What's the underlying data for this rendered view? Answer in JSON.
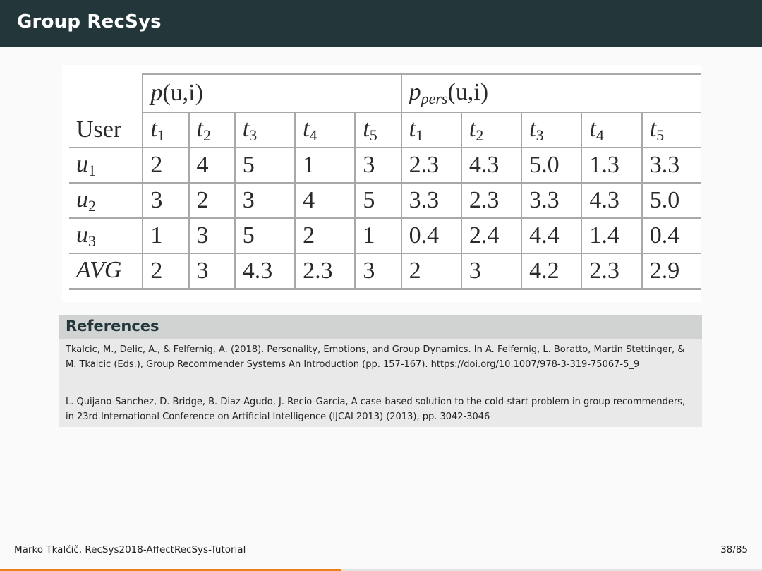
{
  "slide": {
    "title": "Group RecSys"
  },
  "table": {
    "user_header": "User",
    "group1_base": "p",
    "group1_args": "(u,i)",
    "group2_base": "p",
    "group2_sub": "pers",
    "group2_args": "(u,i)",
    "columns": [
      {
        "base": "t",
        "sub": "1"
      },
      {
        "base": "t",
        "sub": "2"
      },
      {
        "base": "t",
        "sub": "3"
      },
      {
        "base": "t",
        "sub": "4"
      },
      {
        "base": "t",
        "sub": "5"
      },
      {
        "base": "t",
        "sub": "1"
      },
      {
        "base": "t",
        "sub": "2"
      },
      {
        "base": "t",
        "sub": "3"
      },
      {
        "base": "t",
        "sub": "4"
      },
      {
        "base": "t",
        "sub": "5"
      }
    ],
    "rows": [
      {
        "label": "u",
        "label_sub": "1",
        "values": [
          "2",
          "4",
          "5",
          "1",
          "3",
          "2.3",
          "4.3",
          "5.0",
          "1.3",
          "3.3"
        ]
      },
      {
        "label": "u",
        "label_sub": "2",
        "values": [
          "3",
          "2",
          "3",
          "4",
          "5",
          "3.3",
          "2.3",
          "3.3",
          "4.3",
          "5.0"
        ]
      },
      {
        "label": "u",
        "label_sub": "3",
        "values": [
          "1",
          "3",
          "5",
          "2",
          "1",
          "0.4",
          "2.4",
          "4.4",
          "1.4",
          "0.4"
        ]
      },
      {
        "label": "AVG",
        "label_sub": "",
        "values": [
          "2",
          "3",
          "4.3",
          "2.3",
          "3",
          "2",
          "3",
          "4.2",
          "2.3",
          "2.9"
        ]
      }
    ]
  },
  "references": {
    "title": "References",
    "items": [
      "Tkalcic, M., Delic, A., & Felfernig, A. (2018). Personality, Emotions, and Group Dynamics. In A. Felfernig, L. Boratto, Martin Stettinger, & M. Tkalcic (Eds.), Group Recommender Systems An Introduction (pp. 157-167). https://doi.org/10.1007/978-3-319-75067-5_9",
      "L. Quijano-Sanchez, D. Bridge, B. Diaz-Agudo, J. Recio-Garcia, A case-based solution to the cold-start problem in group recommenders, in 23rd International Conference on Artificial Intelligence (IJCAI 2013) (2013), pp. 3042-3046"
    ]
  },
  "footer": {
    "author_talk": "Marko Tkalčič, RecSys2018-AffectRecSys-Tutorial",
    "page": "38/85"
  },
  "progress": {
    "current": 38,
    "total": 85
  },
  "colors": {
    "title_bar": "#23373b",
    "progress_accent": "#eb811b",
    "references_header": "#d0d3d2",
    "references_body": "#e8e9e8"
  }
}
